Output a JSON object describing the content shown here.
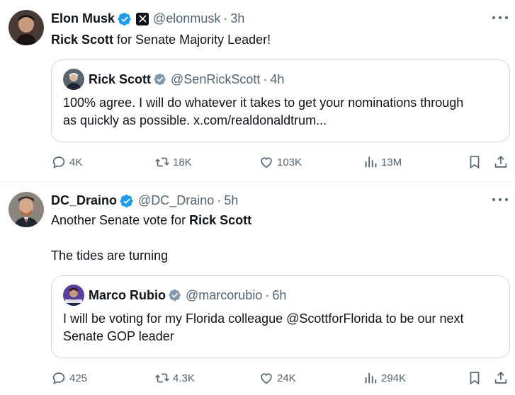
{
  "tweets": [
    {
      "author": "Elon Musk",
      "handle": "@elonmusk",
      "time": "3h",
      "text_bold": "Rick Scott",
      "text_rest": " for Senate Majority Leader!",
      "quote": {
        "author": "Rick Scott",
        "handle": "@SenRickScott",
        "time": "4h",
        "line1": "100% agree. I will do whatever it takes to get your nominations through",
        "line2": "as quickly as possible. x.com/realdonaldtrum..."
      },
      "stats": {
        "replies": "4K",
        "reposts": "18K",
        "likes": "103K",
        "views": "13M"
      }
    },
    {
      "author": "DC_Draino",
      "handle": "@DC_Draino",
      "time": "5h",
      "text_plain": "Another Senate vote for ",
      "text_bold": "Rick Scott",
      "text_line2": "The tides are turning",
      "quote": {
        "author": "Marco Rubio",
        "handle": "@marcorubio",
        "time": "6h",
        "line1": "I will be voting for my Florida colleague @ScottforFlorida to be our next",
        "line2": "Senate GOP leader"
      },
      "stats": {
        "replies": "425",
        "reposts": "4.3K",
        "likes": "24K",
        "views": "294K"
      }
    }
  ],
  "separator": "·",
  "colors": {
    "verified": "#1d9bf0",
    "muted": "#536471",
    "text": "#0f1419",
    "border": "#cfd9de"
  },
  "icons": [
    "verified-badge-icon",
    "x-logo-icon",
    "more-icon",
    "reply-icon",
    "repost-icon",
    "like-icon",
    "views-icon",
    "bookmark-icon",
    "share-icon"
  ]
}
